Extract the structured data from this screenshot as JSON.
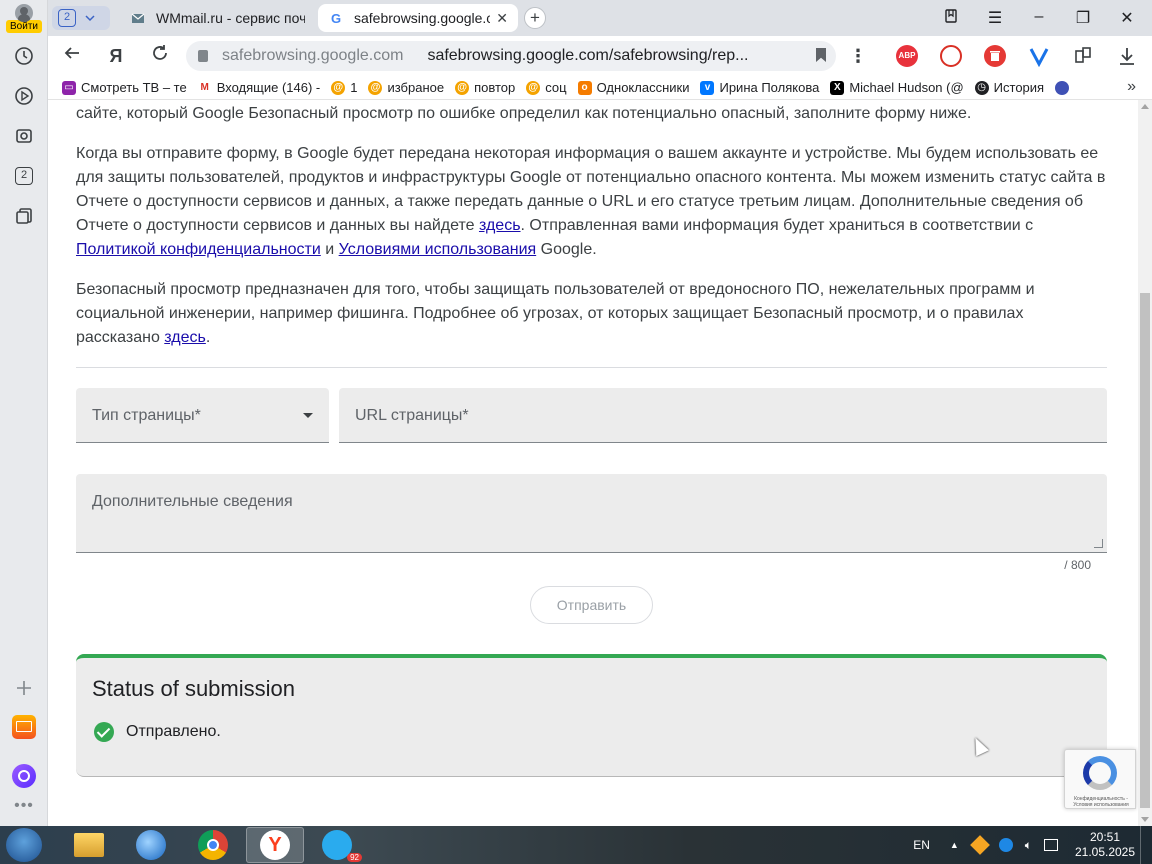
{
  "sidebar": {
    "login_label": "Войти",
    "items": [
      {
        "icon": "history-icon"
      },
      {
        "icon": "play-circle-icon"
      },
      {
        "icon": "camera-icon"
      },
      {
        "icon": "tab-count-icon",
        "label": "2"
      },
      {
        "icon": "collections-icon"
      }
    ],
    "bottom": [
      {
        "icon": "plus-icon"
      },
      {
        "icon": "mail-icon"
      },
      {
        "icon": "alice-icon"
      },
      {
        "icon": "more-icon"
      }
    ]
  },
  "tabs": {
    "counter": "2",
    "items": [
      {
        "title": "WMmail.ru - сервис почто"
      },
      {
        "title": "safebrowsing.google.co"
      }
    ]
  },
  "address": {
    "host": "safebrowsing.google.com",
    "url": "safebrowsing.google.com/safebrowsing/rep..."
  },
  "extensions": [
    {
      "label": "ABP",
      "color": "#e8323c"
    },
    {
      "label": "",
      "color": "#d93025"
    },
    {
      "label": "",
      "color": "#e53935"
    },
    {
      "label": "",
      "color": "#1a73e8"
    }
  ],
  "bookmarks": [
    {
      "label": "Смотреть ТВ – те",
      "color": "#8e24aa"
    },
    {
      "label": "Входящие (146) -",
      "color": "#d93025"
    },
    {
      "label": "1",
      "color": "#f4a300"
    },
    {
      "label": "избраное",
      "color": "#f4a300"
    },
    {
      "label": "повтор",
      "color": "#f4a300"
    },
    {
      "label": "соц",
      "color": "#f4a300"
    },
    {
      "label": "Одноклассники",
      "color": "#f57c00"
    },
    {
      "label": "Ирина Полякова",
      "color": "#0077ff"
    },
    {
      "label": "Michael Hudson (@",
      "color": "#000000"
    },
    {
      "label": "История",
      "color": "#202124"
    }
  ],
  "content": {
    "p0": "сайте, который Google Безопасный просмотр по ошибке определил как потенциально опасный, заполните форму ниже.",
    "p1_a": "Когда вы отправите форму, в Google будет передана некоторая информация о вашем аккаунте и устройстве. Мы будем использовать ее для защиты пользователей, продуктов и инфраструктуры Google от потенциально опасного контента. Мы можем изменить статус сайта в Отчете о доступности сервисов и данных, а также передать данные о URL и его статусе третьим лицам. Дополнительные сведения об Отчете о доступности сервисов и данных вы найдете ",
    "p1_link1": "здесь",
    "p1_b": ". Отправленная вами информация будет храниться в соответствии с ",
    "p1_link2": "Политикой конфиденциальности",
    "p1_c": " и ",
    "p1_link3": "Условиями использования",
    "p1_d": " Google.",
    "p2_a": "Безопасный просмотр предназначен для того, чтобы защищать пользователей от вредоносного ПО, нежелательных программ и социальной инженерии, например фишинга. Подробнее об угрозах, от которых защищает Безопасный просмотр, и о правилах рассказано ",
    "p2_link": "здесь",
    "p2_b": "."
  },
  "form": {
    "page_type_label": "Тип страницы*",
    "page_url_label": "URL страницы*",
    "details_label": "Дополнительные сведения",
    "counter": "/ 800",
    "submit_label": "Отправить"
  },
  "status": {
    "title": "Status of submission",
    "message": "Отправлено.",
    "color": "#34a853"
  },
  "recaptcha": {
    "text": "Конфиденциальность - Условия использования"
  },
  "taskbar": {
    "lang": "EN",
    "time": "20:51",
    "date": "21.05.2025",
    "telegram_badge": "92"
  }
}
